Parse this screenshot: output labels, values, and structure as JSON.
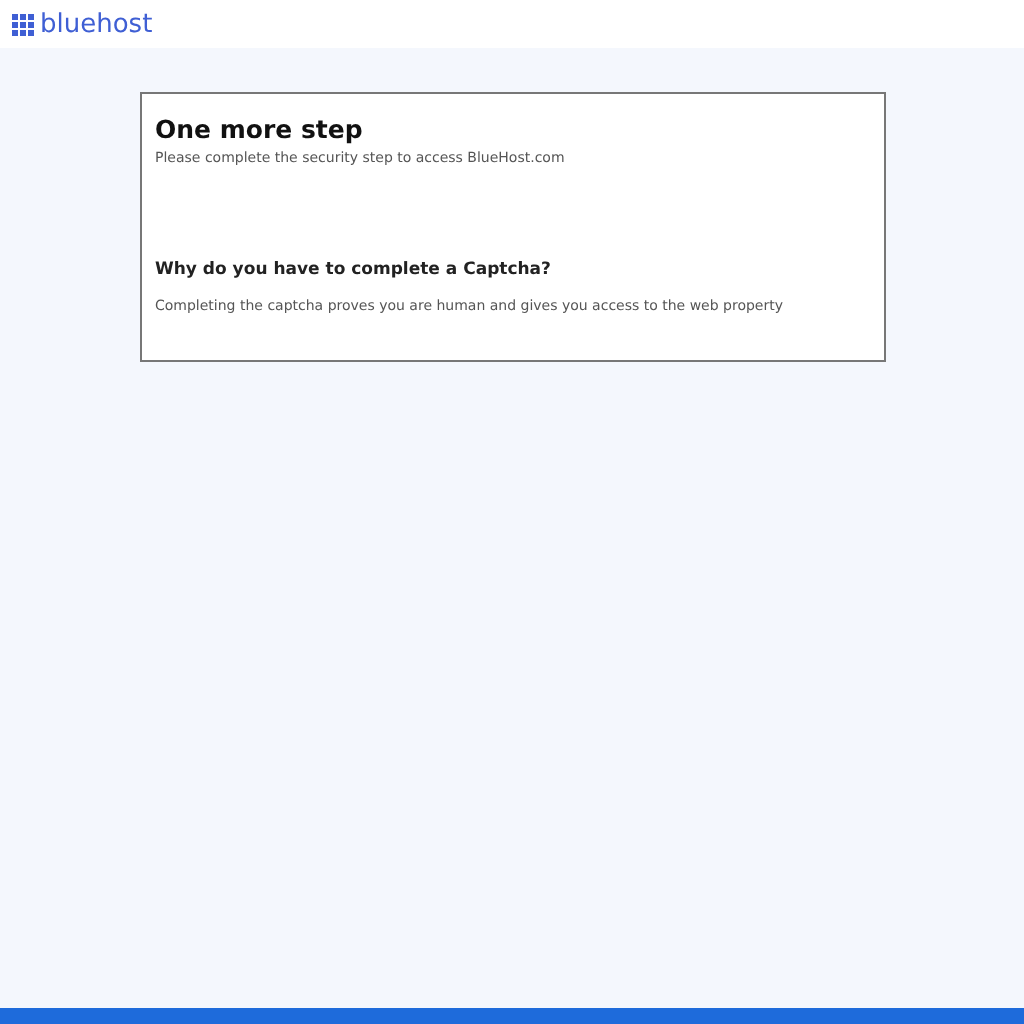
{
  "header": {
    "logo_text": "bluehost"
  },
  "card": {
    "title": "One more step",
    "subtitle": "Please complete the security step to access BlueHost.com",
    "question": "Why do you have to complete a Captcha?",
    "answer": "Completing the captcha proves you are human and gives you access to the web property"
  }
}
